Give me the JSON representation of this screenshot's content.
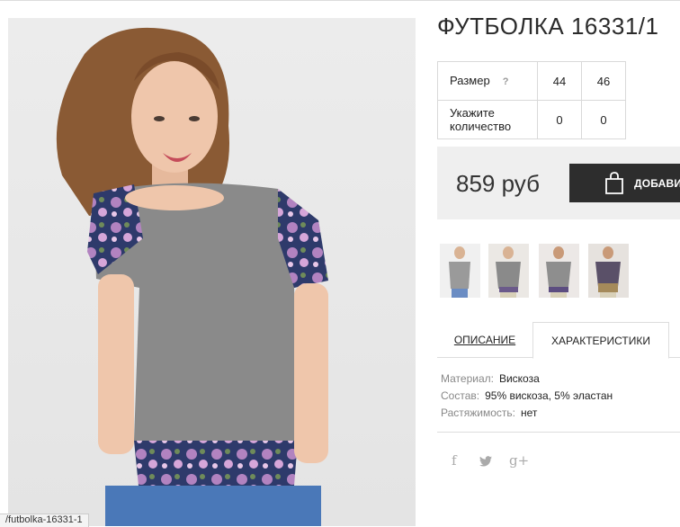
{
  "product": {
    "title": "ФУТБОЛКА 16331/1",
    "photo_alt": "model-wearing-tshirt"
  },
  "size_table": {
    "size_label": "Размер",
    "help_mark": "?",
    "sizes": [
      "44",
      "46"
    ],
    "qty_label": "Укажите количество",
    "qty": [
      "0",
      "0"
    ]
  },
  "price_box": {
    "price": "859 руб",
    "add_button_label": "ДОБАВИТЬ",
    "add_button_icon": "shopping-bag-icon"
  },
  "tabs": {
    "description": "ОПИСАНИЕ",
    "characteristics": "ХАРАКТЕРИСТИКИ",
    "active": "characteristics"
  },
  "specs": [
    {
      "key": "Материал:",
      "value": "Вискоза"
    },
    {
      "key": "Состав:",
      "value": "95% вискоза, 5% эластан"
    },
    {
      "key": "Растяжимость:",
      "value": "нет"
    }
  ],
  "social": {
    "facebook": "f",
    "twitter_icon": "twitter-icon",
    "googleplus": "g+"
  },
  "status_url": "/futbolka-16331-1",
  "colors": {
    "button_bg": "#2d2d2d",
    "price_bg": "#efefef",
    "shirt_grey": "#8a8a8a",
    "floral_navy": "#2e3a6b",
    "jeans_blue": "#4a78b8"
  }
}
